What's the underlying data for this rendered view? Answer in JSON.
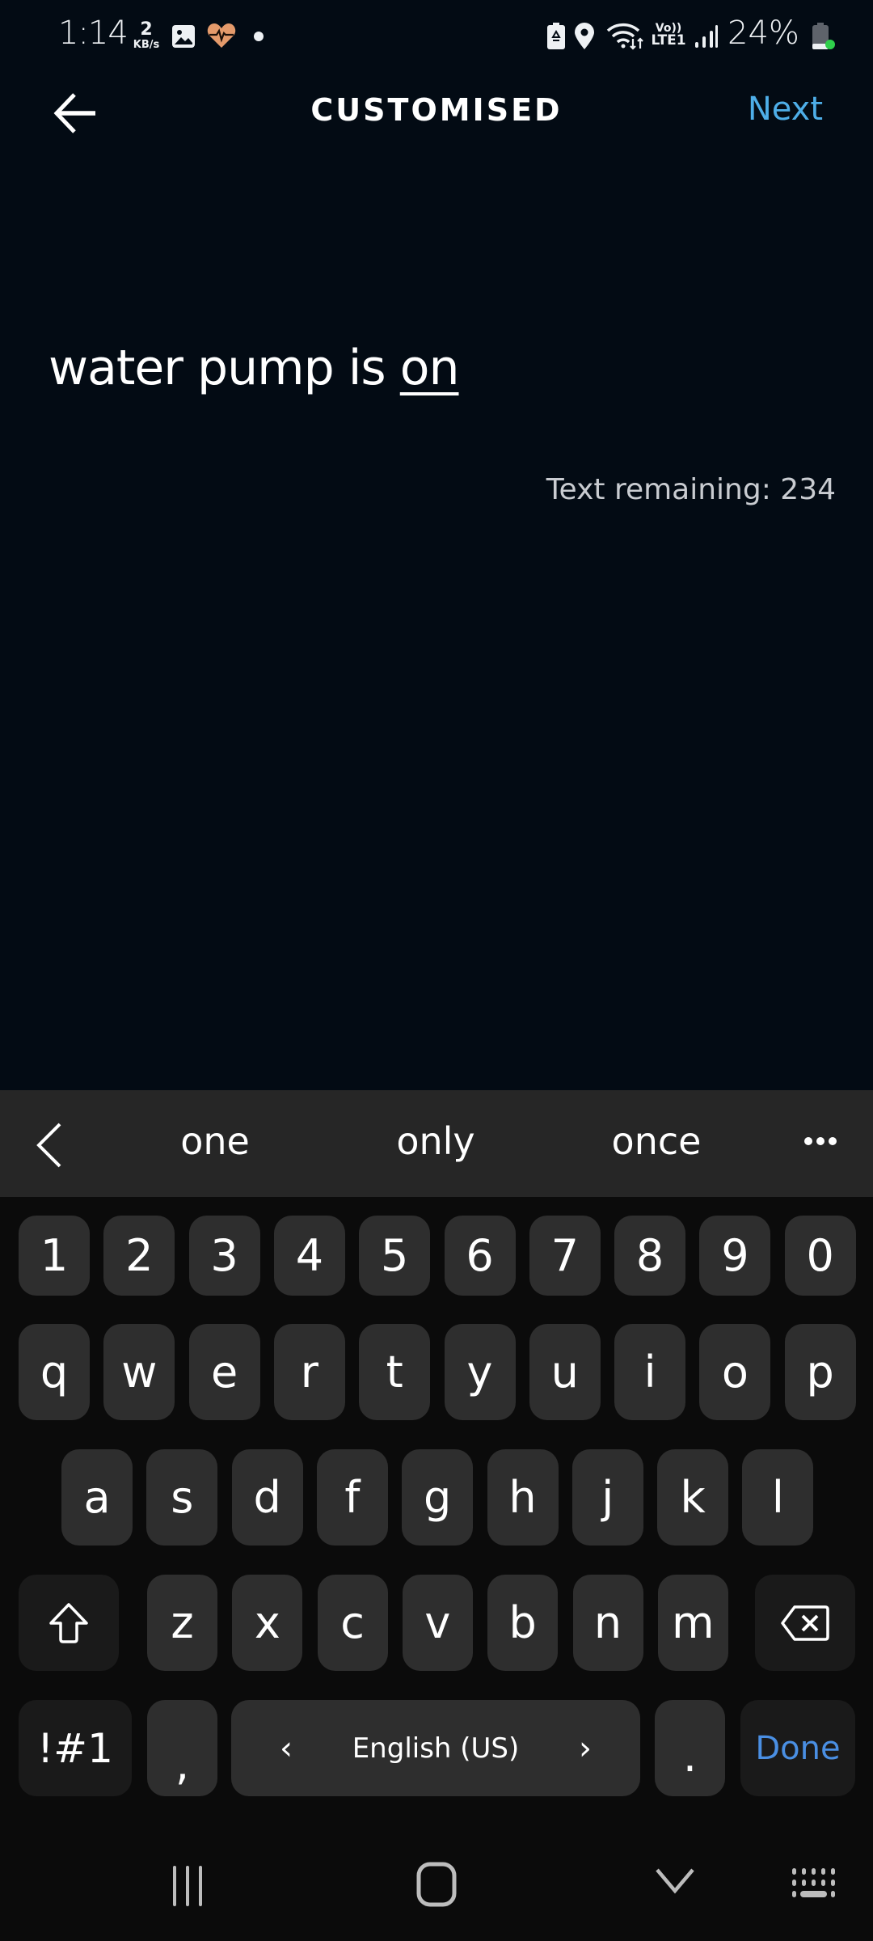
{
  "status_bar": {
    "time": "1:14",
    "net_speed_value": "2",
    "net_speed_unit": "KB/s",
    "battery_percent": "24%",
    "icons": [
      "gallery-icon",
      "health-heart-icon",
      "dot-icon",
      "battery-saver-icon",
      "location-icon",
      "wifi-icon",
      "volte-icon",
      "signal-icon",
      "battery-icon",
      "privacy-dot-icon"
    ],
    "volte_top": "Vo))",
    "volte_bottom": "LTE1"
  },
  "header": {
    "title": "CUSTOMISED",
    "next_label": "Next"
  },
  "content": {
    "phrase_prefix": "water pump is ",
    "phrase_slot": "on",
    "remaining_label": "Text remaining: 234"
  },
  "keyboard": {
    "suggestions": [
      "one",
      "only",
      "once"
    ],
    "number_row": [
      "1",
      "2",
      "3",
      "4",
      "5",
      "6",
      "7",
      "8",
      "9",
      "0"
    ],
    "row1": [
      "q",
      "w",
      "e",
      "r",
      "t",
      "y",
      "u",
      "i",
      "o",
      "p"
    ],
    "row2": [
      "a",
      "s",
      "d",
      "f",
      "g",
      "h",
      "j",
      "k",
      "l"
    ],
    "row3": [
      "z",
      "x",
      "c",
      "v",
      "b",
      "n",
      "m"
    ],
    "symbols_label": "!#1",
    "comma_label": ",",
    "space_label": "English (US)",
    "space_left_arrow": "‹",
    "space_right_arrow": "›",
    "period_label": ".",
    "done_label": "Done",
    "accent_color": "#4a8fe3"
  },
  "colors": {
    "next_link": "#4eaee8",
    "background": "#030b14"
  }
}
